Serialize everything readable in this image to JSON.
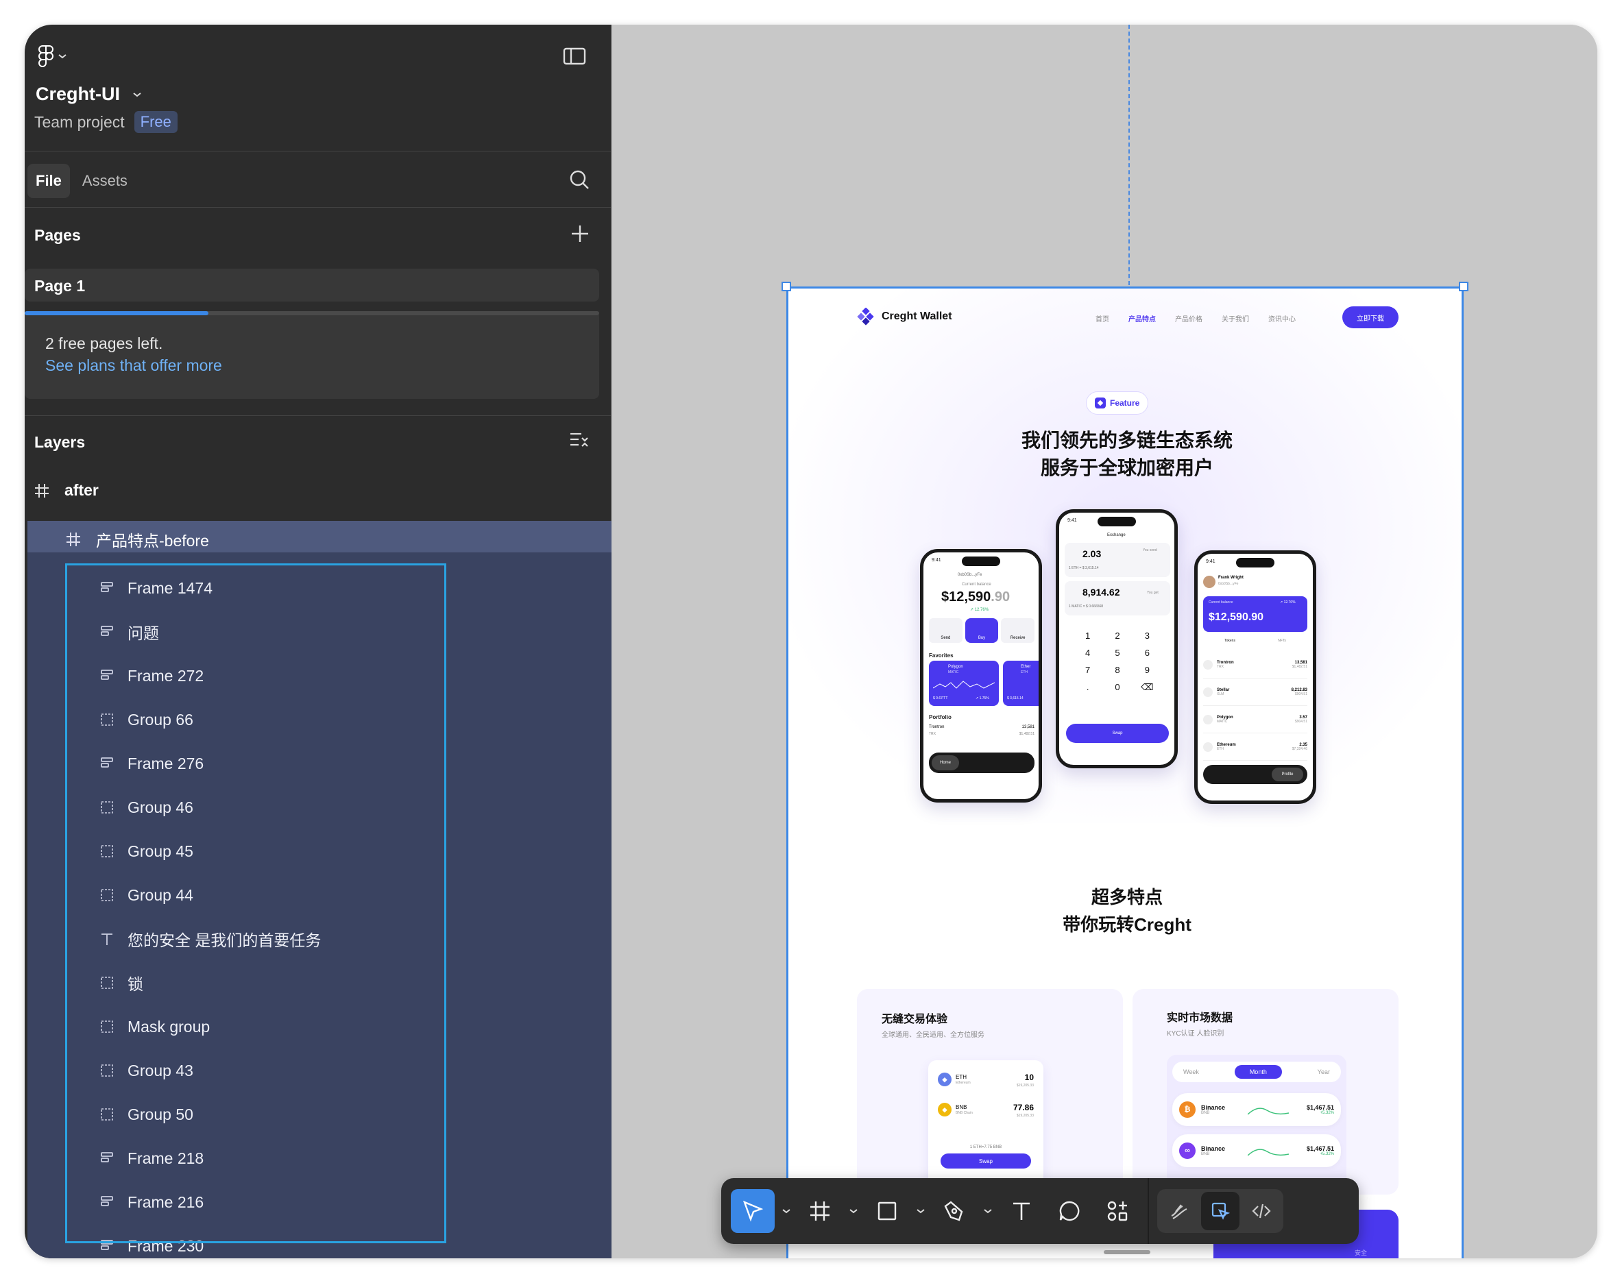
{
  "sidebar": {
    "project_name": "Creght-UI",
    "project_type": "Team project",
    "plan_badge": "Free",
    "tabs": {
      "file": "File",
      "assets": "Assets"
    },
    "pages_heading": "Pages",
    "current_page": "Page 1",
    "free_pages_progress": 0.32,
    "notice_text": "2 free pages left.",
    "notice_link": "See plans that offer more",
    "layers_heading": "Layers",
    "root_frame": "after",
    "selected_frame": "产品特点-before",
    "layers": [
      {
        "name": "Frame 1474",
        "icon": "frame-autolayout-icon"
      },
      {
        "name": "问题",
        "icon": "frame-autolayout-icon"
      },
      {
        "name": "Frame 272",
        "icon": "frame-autolayout-icon"
      },
      {
        "name": "Group 66",
        "icon": "group-icon"
      },
      {
        "name": "Frame 276",
        "icon": "frame-autolayout-icon"
      },
      {
        "name": "Group 46",
        "icon": "group-icon"
      },
      {
        "name": "Group 45",
        "icon": "group-icon"
      },
      {
        "name": "Group 44",
        "icon": "group-icon"
      },
      {
        "name": "您的安全 是我们的首要任务",
        "icon": "text-icon"
      },
      {
        "name": "锁",
        "icon": "group-icon"
      },
      {
        "name": "Mask group",
        "icon": "group-icon"
      },
      {
        "name": "Group 43",
        "icon": "group-icon"
      },
      {
        "name": "Group 50",
        "icon": "group-icon"
      },
      {
        "name": "Frame 218",
        "icon": "frame-autolayout-icon"
      },
      {
        "name": "Frame 216",
        "icon": "frame-autolayout-icon"
      },
      {
        "name": "Frame 230",
        "icon": "frame-autolayout-icon"
      }
    ]
  },
  "frame": {
    "brand": "Creght Wallet",
    "nav": [
      "首页",
      "产品特点",
      "产品价格",
      "关于我们",
      "资讯中心"
    ],
    "cta": "立即下载",
    "badge": "Feature",
    "headline_1": "我们领先的多链生态系统",
    "headline_2": "服务于全球加密用户",
    "phone_left": {
      "time": "9:41",
      "address": "0xb0Sb...yFe",
      "balance_label": "Current balance",
      "balance": "$12,590",
      "balance_cents": ".90",
      "change": "↗ 12.76%",
      "actions": [
        "Send",
        "Buy",
        "Receive"
      ],
      "favorites": "Favorites",
      "fav_card_1": "Polygon",
      "fav_card_1_sub": "MATIC",
      "fav_card_1_value": "$ 0.67/TT",
      "fav_card_1_change": "↗ 1.75%",
      "fav_card_2": "Ether",
      "fav_card_2_sub": "ETH",
      "fav_card_2_value": "$ 3,615.14",
      "portfolio": "Portfolio",
      "row_name": "Trontron",
      "row_sub": "TRX",
      "row_amount": "13,581",
      "row_value": "$1,482.51",
      "home": "Home"
    },
    "phone_mid": {
      "time": "9:41",
      "title": "Exchange",
      "send_amount": "2.03",
      "send_label": "You send",
      "rate_1": "1 ETH = $ 3,615.14",
      "get_amount": "8,914.62",
      "get_label": "You get",
      "rate_2": "1 MATIC = $ 0.666568",
      "keys": [
        "1",
        "2",
        "3",
        "4",
        "5",
        "6",
        "7",
        "8",
        "9",
        ".",
        "0",
        "⌫"
      ],
      "swap": "Swap"
    },
    "phone_right": {
      "time": "9:41",
      "user": "Frank Wright",
      "address": "0xb0Sb...yFe",
      "balance_label": "Current balance",
      "change": "↗ 12.76%",
      "balance": "$12,590.90",
      "tab_tokens": "Tokens",
      "tab_nfts": "NFTs",
      "rows": [
        {
          "name": "Trontron",
          "sub": "TRX",
          "amount": "13,581",
          "value": "$1,482.51"
        },
        {
          "name": "Stellar",
          "sub": "XLM",
          "amount": "8,212.83",
          "value": "$904.51"
        },
        {
          "name": "Polygon",
          "sub": "MATIC",
          "amount": "3.57",
          "value": "$904.51"
        },
        {
          "name": "Ethereum",
          "sub": "ETH",
          "amount": "2.35",
          "value": "$7,324.46"
        }
      ],
      "profile": "Profile"
    },
    "section_title_1": "超多特点",
    "section_title_2": "带你玩转Creght",
    "card_left": {
      "title": "无缝交易体验",
      "subtitle": "全球通用、全民适用、全方位服务",
      "row1_name": "ETH",
      "row1_sub": "Ethereum",
      "row1_amount": "10",
      "row1_value": "$19,205.33",
      "row2_name": "BNB",
      "row2_sub": "BNB Chain",
      "row2_amount": "77.86",
      "row2_value": "$19,205.33",
      "rate": "1 ETH=7.75 BNB",
      "swap": "Swap"
    },
    "card_right": {
      "title": "实时市场数据",
      "subtitle": "KYC认证 人脸识别",
      "segments": [
        "Week",
        "Month",
        "Year"
      ],
      "rows": [
        {
          "name": "Binance",
          "sub": "BNB",
          "price": "$1,467.51",
          "change": "+5.32%"
        },
        {
          "name": "Binance",
          "sub": "BNB",
          "price": "$1,467.51",
          "change": "+5.32%"
        }
      ]
    },
    "bottom_card_text": "安全"
  },
  "toolbar": {
    "tools": [
      "move-tool",
      "frame-tool",
      "shape-tool",
      "pen-tool",
      "text-tool",
      "comment-tool",
      "actions-tool"
    ],
    "modes": [
      "draw-mode",
      "design-mode",
      "dev-mode"
    ]
  },
  "colors": {
    "accent": "#3a87e6",
    "brand": "#4a38ee",
    "selection": "#2aa3e2"
  }
}
